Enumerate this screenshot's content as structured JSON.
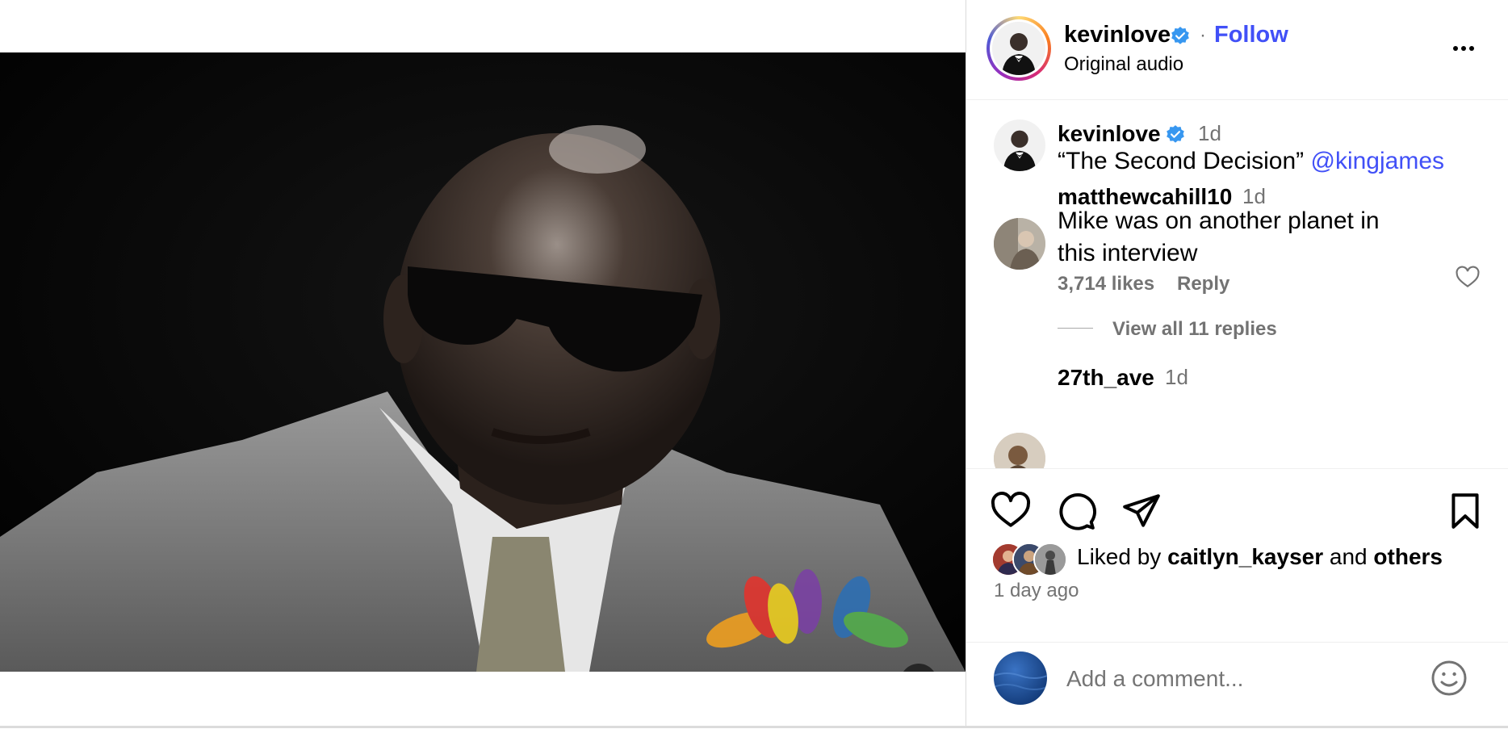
{
  "post": {
    "username": "kevinlove",
    "separator": "·",
    "follow_label": "Follow",
    "audio_label": "Original audio",
    "caption_time": "1d",
    "caption_text": "“The Second Decision” ",
    "caption_mention": "@kingjames"
  },
  "comments": [
    {
      "username": "matthewcahill10",
      "time": "1d",
      "text_line1": "Mike was on another planet in",
      "text_line2": "this interview",
      "likes": "3,714 likes",
      "reply_label": "Reply",
      "view_replies": "View all 11 replies"
    },
    {
      "username": "27th_ave",
      "time": "1d"
    }
  ],
  "likes": {
    "prefix": "Liked by ",
    "user": "caitlyn_kayser",
    "middle": " and ",
    "others": "others",
    "timestamp": "1 day ago"
  },
  "add_comment": {
    "placeholder": "Add a comment..."
  },
  "video": {
    "watermark_icon": "nbc-peacock-logo",
    "mute_icon": "muted-speaker-icon"
  },
  "colors": {
    "link_blue": "#4150f7",
    "verified_blue": "#3797f0",
    "muted_text": "#737373"
  }
}
